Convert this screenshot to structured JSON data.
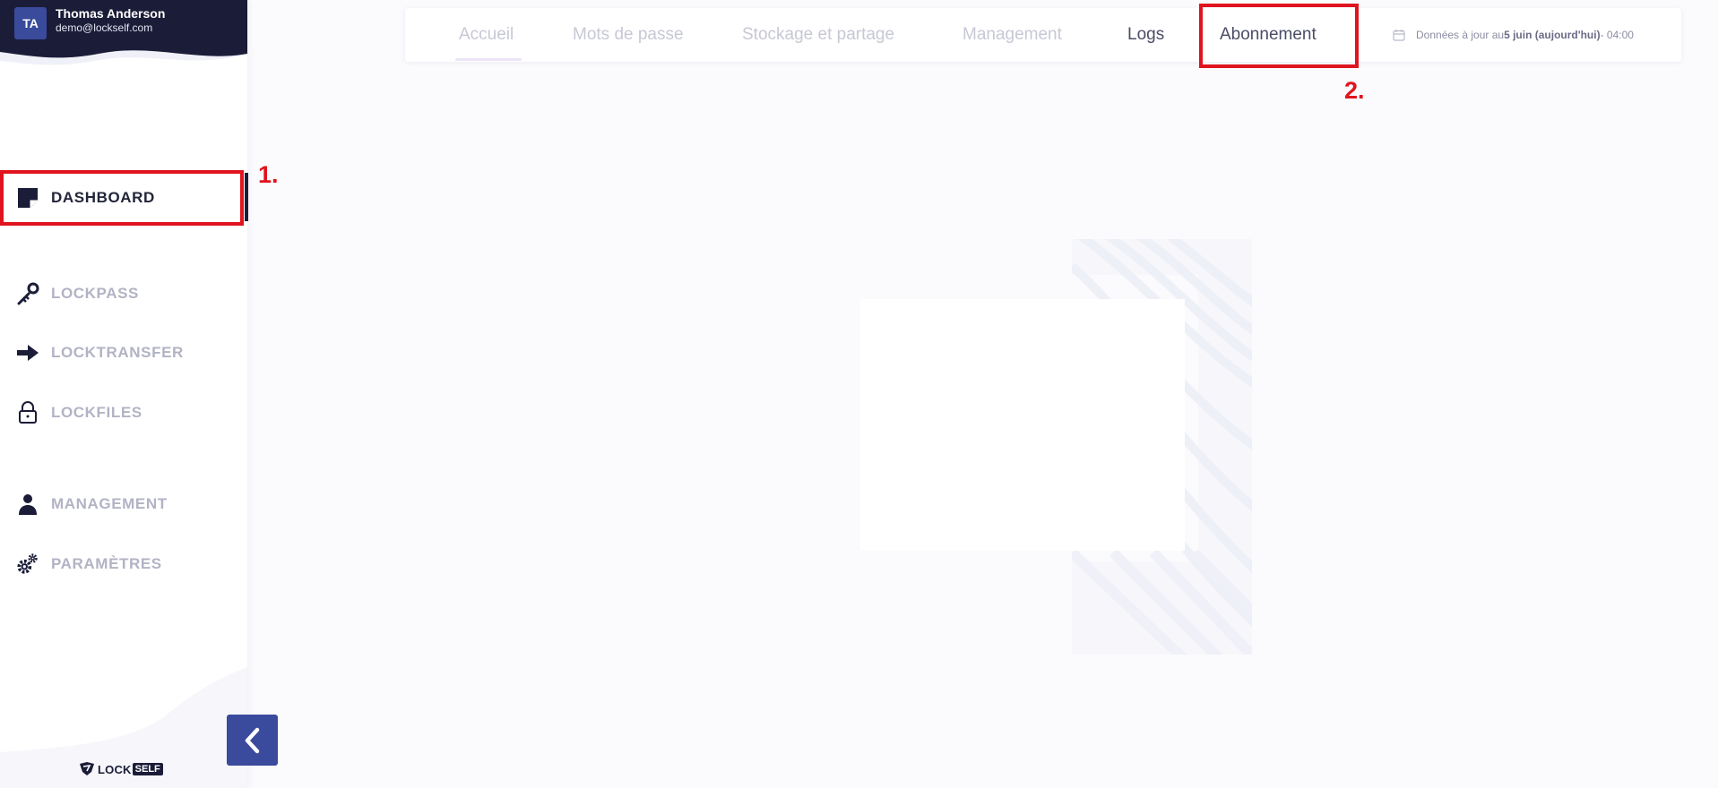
{
  "user": {
    "initials": "TA",
    "name": "Thomas Anderson",
    "email": "demo@lockself.com"
  },
  "sidebar": {
    "items": [
      {
        "label": "DASHBOARD",
        "icon": "dashboard-icon",
        "active": true
      },
      {
        "label": "LOCKPASS",
        "icon": "key-icon"
      },
      {
        "label": "LOCKTRANSFER",
        "icon": "arrow-right-icon"
      },
      {
        "label": "LOCKFILES",
        "icon": "lock-icon"
      },
      {
        "label": "MANAGEMENT",
        "icon": "user-icon"
      },
      {
        "label": "PARAMÈTRES",
        "icon": "gears-icon"
      }
    ],
    "collapse_icon": "chevron-left-icon"
  },
  "logo": {
    "word": "LOCK",
    "badge": "SELF"
  },
  "tabs": [
    {
      "label": "Accueil"
    },
    {
      "label": "Mots de passe"
    },
    {
      "label": "Stockage et partage"
    },
    {
      "label": "Management"
    },
    {
      "label": "Logs"
    },
    {
      "label": "Abonnement"
    }
  ],
  "updated": {
    "prefix": "Données à jour au ",
    "date": "5 juin (aujourd'hui)",
    "suffix": " - 04:00",
    "icon": "calendar-icon"
  },
  "annotations": {
    "first": "1.",
    "second": "2."
  },
  "colors": {
    "sidebar_header": "#1b1c38",
    "accent": "#3a4a9c",
    "highlight": "#e0141e",
    "inactive_text": "#b2b3c4"
  }
}
